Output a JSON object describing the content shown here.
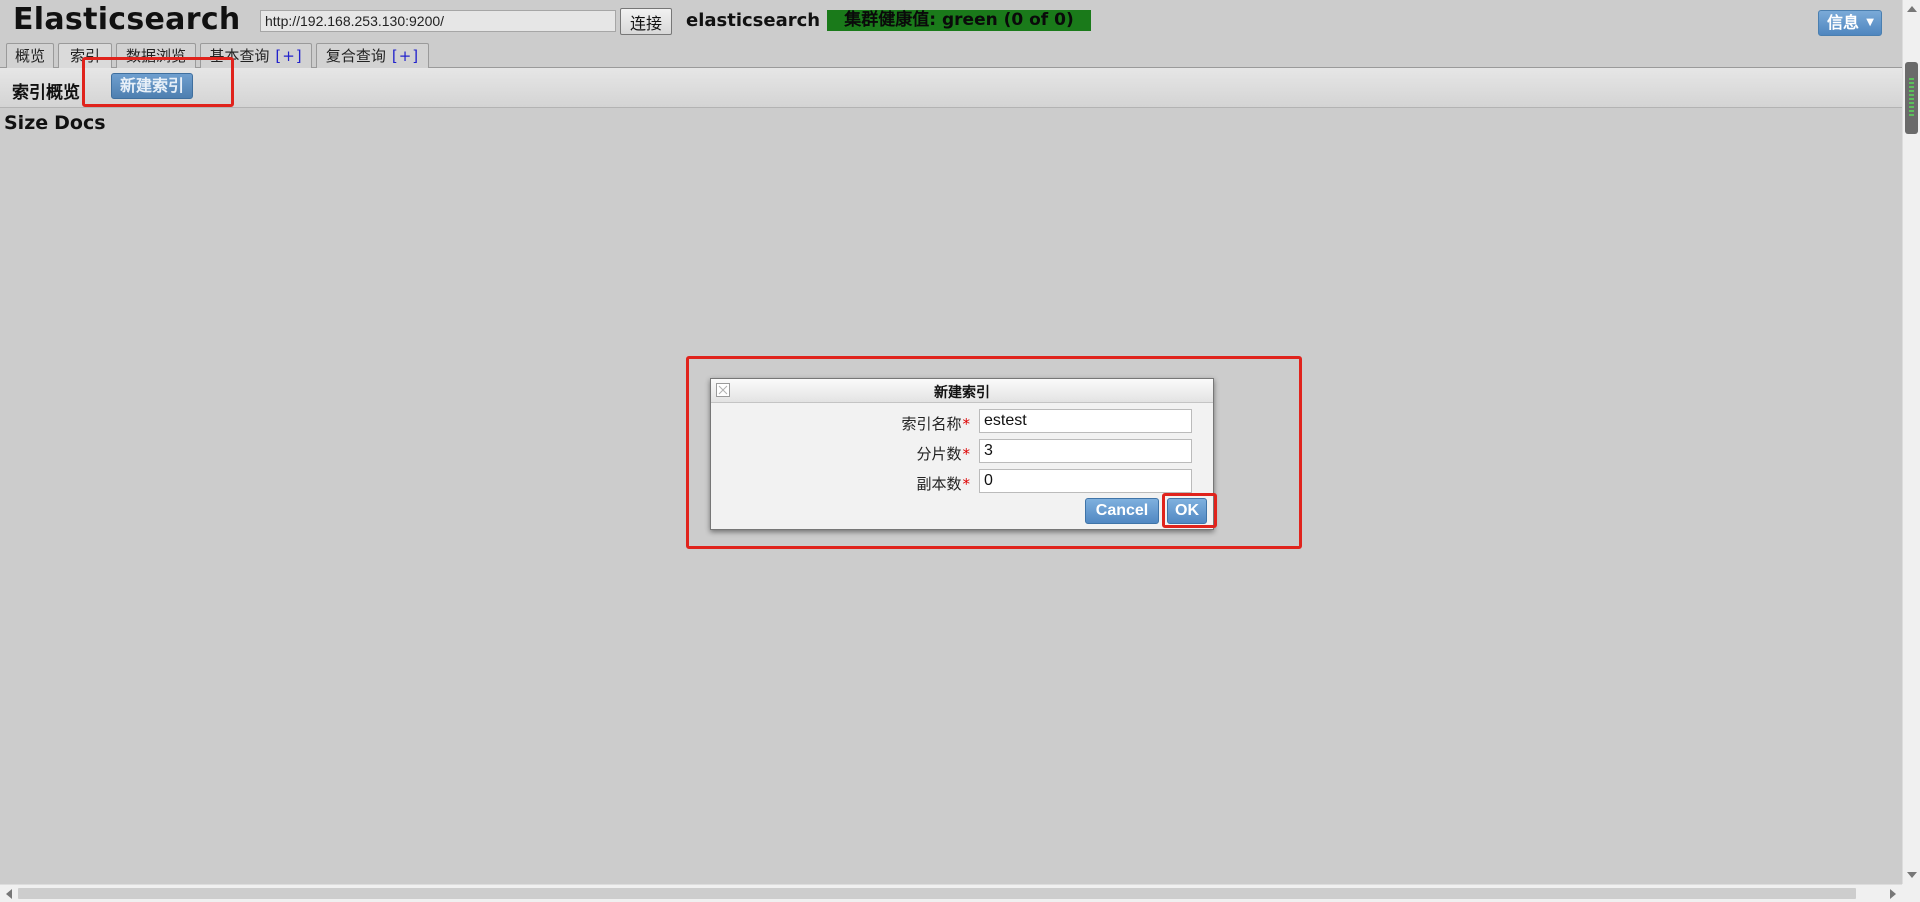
{
  "header": {
    "title": "Elasticsearch",
    "url_value": "http://192.168.253.130:9200/",
    "connect_label": "连接",
    "cluster_name": "elasticsearch",
    "health_text": "集群健康值: green (0 of 0)",
    "info_label": "信息"
  },
  "tabs": [
    {
      "label": "概览"
    },
    {
      "label": "索引"
    },
    {
      "label": "数据浏览"
    },
    {
      "label": "基本查询",
      "plus": "[+]"
    },
    {
      "label": "复合查询",
      "plus": "[+]"
    }
  ],
  "toolbar": {
    "title": "索引概览",
    "new_index_label": "新建索引"
  },
  "stats": {
    "size_label": "Size",
    "docs_label": "Docs"
  },
  "dialog": {
    "title": "新建索引",
    "fields": [
      {
        "label": "索引名称",
        "required_mark": "*",
        "value": "estest"
      },
      {
        "label": "分片数",
        "required_mark": "*",
        "value": "3"
      },
      {
        "label": "副本数",
        "required_mark": "*",
        "value": "0"
      }
    ],
    "cancel_label": "Cancel",
    "ok_label": "OK"
  },
  "colors": {
    "health_green": "#1a7a1a",
    "button_blue": "#4e7fb0",
    "highlight_red": "#e0231c"
  }
}
